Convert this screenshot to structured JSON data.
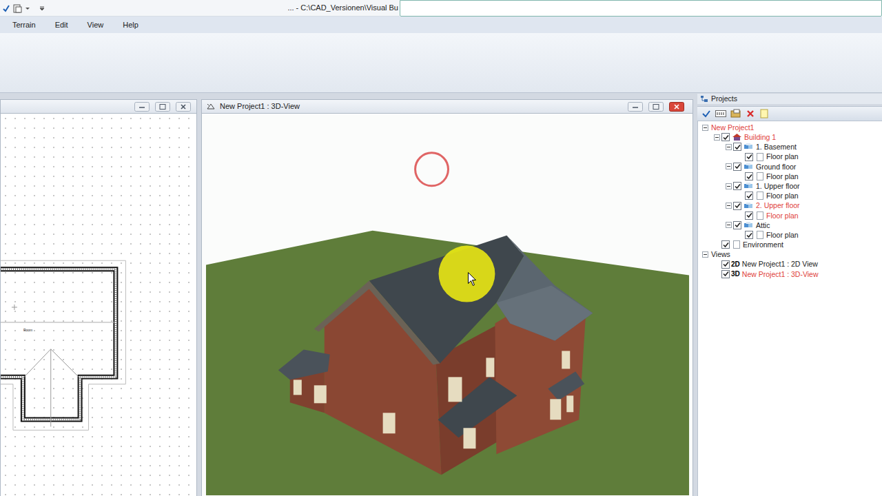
{
  "window": {
    "title": "... - C:\\CAD_Versionen\\Visual Bu"
  },
  "menu": [
    "Terrain",
    "Edit",
    "View",
    "Help"
  ],
  "plan_window": {
    "room_label": "Room"
  },
  "view_window": {
    "title": "New Project1 : 3D-View"
  },
  "projects": {
    "title": "Projects",
    "tree": [
      {
        "label": "New Project1",
        "level": 0,
        "kind": "root",
        "expanded": true,
        "active": true
      },
      {
        "label": "Building 1",
        "level": 1,
        "kind": "building",
        "expanded": true,
        "checked": true,
        "active": true
      },
      {
        "label": "1. Basement",
        "level": 2,
        "kind": "floor",
        "expanded": true,
        "checked": true,
        "active": false
      },
      {
        "label": "Floor plan",
        "level": 3,
        "kind": "plan",
        "checked": true,
        "active": false
      },
      {
        "label": "Ground floor",
        "level": 2,
        "kind": "floor",
        "expanded": true,
        "checked": true,
        "active": false
      },
      {
        "label": "Floor plan",
        "level": 3,
        "kind": "plan",
        "checked": true,
        "active": false
      },
      {
        "label": "1. Upper floor",
        "level": 2,
        "kind": "floor",
        "expanded": true,
        "checked": true,
        "active": false
      },
      {
        "label": "Floor plan",
        "level": 3,
        "kind": "plan",
        "checked": true,
        "active": false
      },
      {
        "label": "2. Upper floor",
        "level": 2,
        "kind": "floor",
        "expanded": true,
        "checked": true,
        "active": true
      },
      {
        "label": "Floor plan",
        "level": 3,
        "kind": "plan",
        "checked": true,
        "active": true
      },
      {
        "label": "Attic",
        "level": 2,
        "kind": "floor",
        "expanded": true,
        "checked": true,
        "active": false
      },
      {
        "label": "Floor plan",
        "level": 3,
        "kind": "plan",
        "checked": true,
        "active": false
      },
      {
        "label": "Environment",
        "level": 1,
        "kind": "environment",
        "checked": true,
        "active": false
      },
      {
        "label": "Views",
        "level": 0,
        "kind": "views",
        "expanded": true,
        "active": false
      },
      {
        "label": "New Project1 : 2D View",
        "prefix": "2D",
        "level": 1,
        "kind": "view",
        "checked": true,
        "active": false
      },
      {
        "label": "New Project1 : 3D-View",
        "prefix": "3D",
        "level": 1,
        "kind": "view",
        "checked": true,
        "active": true
      }
    ]
  }
}
